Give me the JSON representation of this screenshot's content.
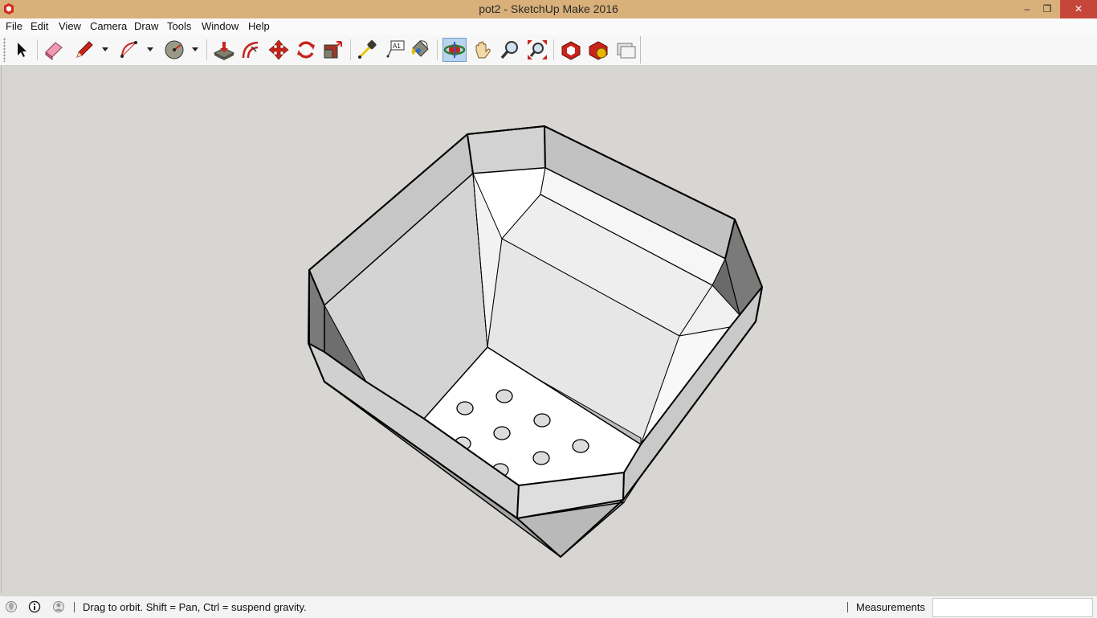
{
  "window": {
    "title": "pot2 - SketchUp Make 2016",
    "minimize_glyph": "–",
    "restore_glyph": "❐",
    "close_glyph": "✕"
  },
  "menu": [
    "File",
    "Edit",
    "View",
    "Camera",
    "Draw",
    "Tools",
    "Window",
    "Help"
  ],
  "toolbar": {
    "tools": [
      {
        "name": "select-tool",
        "icon": "arrow-cursor-icon"
      },
      {
        "name": "eraser-tool",
        "icon": "eraser-icon"
      },
      {
        "name": "line-tool",
        "icon": "pencil-icon"
      },
      {
        "name": "arc-tool",
        "icon": "arc-icon"
      },
      {
        "name": "shapes-tool",
        "icon": "circle-shape-icon"
      },
      {
        "name": "push-pull-tool",
        "icon": "push-pull-icon"
      },
      {
        "name": "offset-tool",
        "icon": "offset-icon"
      },
      {
        "name": "move-tool",
        "icon": "move-arrows-icon"
      },
      {
        "name": "rotate-tool",
        "icon": "rotate-icon"
      },
      {
        "name": "scale-tool",
        "icon": "scale-icon"
      },
      {
        "name": "tape-measure-tool",
        "icon": "tape-measure-icon"
      },
      {
        "name": "text-tool",
        "icon": "text-label-icon"
      },
      {
        "name": "paint-bucket-tool",
        "icon": "paint-bucket-icon"
      },
      {
        "name": "orbit-tool",
        "icon": "orbit-icon",
        "active": true
      },
      {
        "name": "pan-tool",
        "icon": "hand-icon"
      },
      {
        "name": "zoom-tool",
        "icon": "magnifier-icon"
      },
      {
        "name": "zoom-extents-tool",
        "icon": "zoom-extents-icon"
      },
      {
        "name": "3d-warehouse",
        "icon": "warehouse-icon"
      },
      {
        "name": "extension-warehouse",
        "icon": "extension-icon"
      },
      {
        "name": "share-model",
        "icon": "share-icon"
      }
    ]
  },
  "status": {
    "hint": "Drag to orbit. Shift = Pan, Ctrl = suspend gravity.",
    "measurements_label": "Measurements",
    "measurements_value": ""
  }
}
